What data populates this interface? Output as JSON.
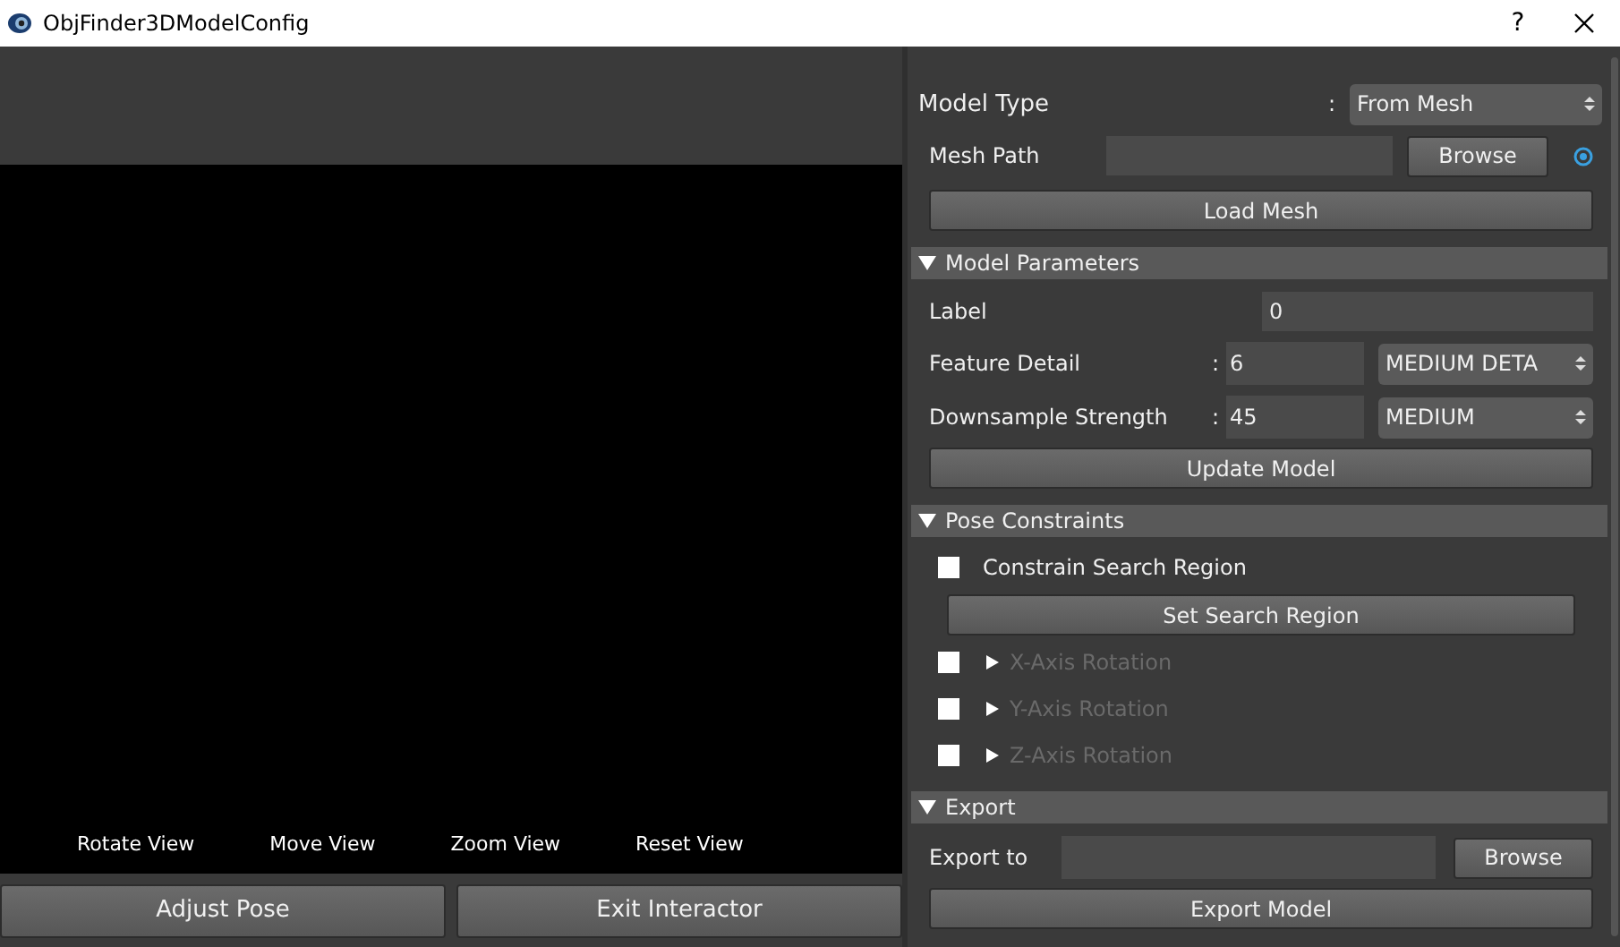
{
  "window": {
    "title": "ObjFinder3DModelConfig",
    "help_button": "?"
  },
  "viewer": {
    "view_controls": [
      "Rotate View",
      "Move View",
      "Zoom View",
      "Reset View"
    ],
    "buttons": [
      "Adjust Pose",
      "Exit Interactor"
    ]
  },
  "config": {
    "model_type": {
      "label": "Model Type",
      "colon": ":",
      "value": "From Mesh"
    },
    "mesh_path": {
      "label": "Mesh Path",
      "button": "Browse",
      "radio_selected": true
    },
    "load_button": "Load Mesh",
    "sections": [
      {
        "title": "Model Parameters",
        "expanded": true,
        "rows": [
          {
            "kind": "field",
            "label": "Label",
            "value": "0"
          },
          {
            "kind": "field_combo",
            "label": "Feature Detail",
            "colon": ":",
            "value": "6",
            "option": "MEDIUM DETA"
          },
          {
            "kind": "field_combo",
            "label": "Downsample Strength",
            "colon": ":",
            "value": "45",
            "option": "MEDIUM"
          },
          {
            "kind": "button",
            "label": "Update Model"
          }
        ]
      },
      {
        "title": "Pose Constraints",
        "expanded": true,
        "rows": [
          {
            "kind": "checkbox",
            "label": "Constrain Search Region",
            "checked": false,
            "disabled": false
          },
          {
            "kind": "button",
            "label": "Set Search Region",
            "inset": true
          },
          {
            "kind": "expander",
            "label": "X-Axis Rotation",
            "checked": false,
            "disabled": true,
            "expanded": false
          },
          {
            "kind": "expander",
            "label": "Y-Axis Rotation",
            "checked": false,
            "disabled": true,
            "expanded": false
          },
          {
            "kind": "expander",
            "label": "Z-Axis Rotation",
            "checked": false,
            "disabled": true,
            "expanded": false
          }
        ]
      },
      {
        "title": "Export",
        "expanded": true,
        "rows": [
          {
            "kind": "path",
            "label": "Export to",
            "button": "Browse"
          },
          {
            "kind": "button",
            "label": "Export Model"
          }
        ]
      }
    ]
  }
}
